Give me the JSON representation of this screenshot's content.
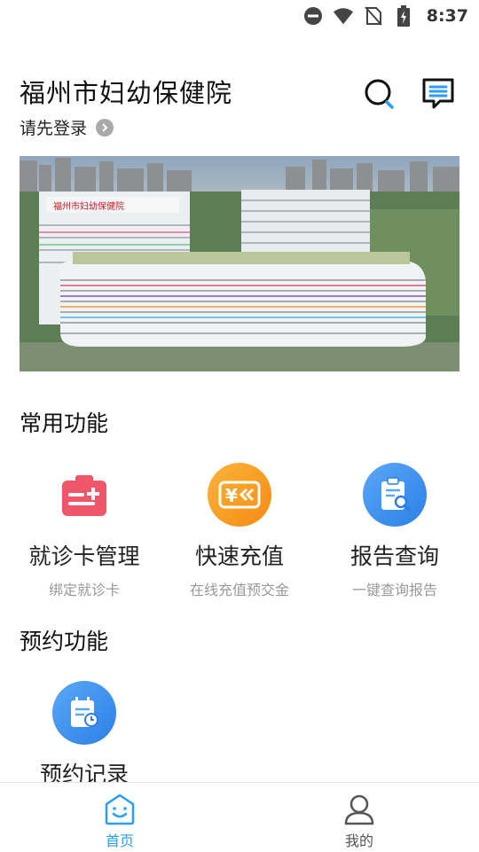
{
  "status_bar": {
    "time": "8:37",
    "icons": [
      "do-not-disturb-icon",
      "wifi-icon",
      "no-sim-icon",
      "battery-charging-icon"
    ]
  },
  "header": {
    "title": "福州市妇幼保健院",
    "login_prompt": "请先登录",
    "icons": [
      "search-icon",
      "message-icon"
    ]
  },
  "banner": {
    "building_sign": "福州市妇幼保健院"
  },
  "common_functions": {
    "title": "常用功能",
    "items": [
      {
        "label": "就诊卡管理",
        "sub": "绑定就诊卡",
        "icon": "medical-card-icon",
        "color": "#f0566a"
      },
      {
        "label": "快速充值",
        "sub": "在线充值预交金",
        "icon": "recharge-yen-icon",
        "color": "#f89a1c"
      },
      {
        "label": "报告查询",
        "sub": "一键查询报告",
        "icon": "report-search-icon",
        "color": "#3e8cf0"
      }
    ]
  },
  "appointment_functions": {
    "title": "预约功能",
    "items": [
      {
        "label": "预约记录",
        "icon": "appointment-record-icon",
        "color": "#3e8cf0"
      }
    ]
  },
  "bottom_nav": {
    "items": [
      {
        "label": "首页",
        "icon": "home-smile-icon",
        "active": true,
        "color": "#2a9df4"
      },
      {
        "label": "我的",
        "icon": "user-profile-icon",
        "active": false,
        "color": "#555555"
      }
    ]
  }
}
